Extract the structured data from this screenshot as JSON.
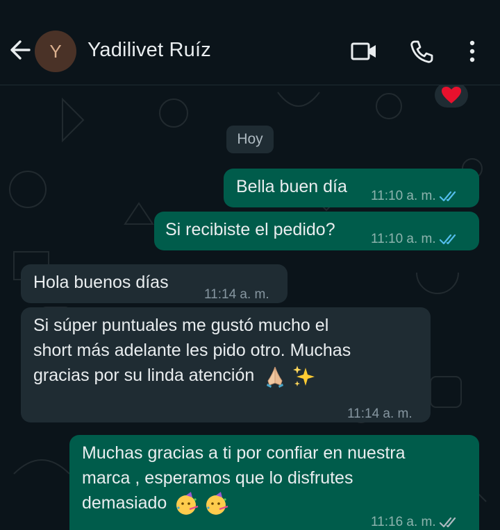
{
  "header": {
    "avatar_initial": "Y",
    "contact_name": "Yadilivet Ruíz",
    "icons": [
      "back-arrow-icon",
      "video-call-icon",
      "phone-icon",
      "more-vertical-icon"
    ]
  },
  "chat": {
    "reaction_emoji": "heart",
    "date_chip": "Hoy",
    "messages": [
      {
        "direction": "out",
        "text": "Bella buen día",
        "time": "11:10 a. m.",
        "status": "read"
      },
      {
        "direction": "out",
        "text": "Si recibiste el pedido?",
        "time": "11:10 a. m.",
        "status": "read"
      },
      {
        "direction": "in",
        "text": "Hola buenos días",
        "time": "11:14 a. m."
      },
      {
        "direction": "in",
        "lines": [
          "Si súper puntuales me gustó mucho el",
          "short más adelante les pido otro. Muchas",
          "gracias por su linda atención"
        ],
        "emojis": [
          "folded-hands",
          "sparkles"
        ],
        "time": "11:14 a. m."
      },
      {
        "direction": "out",
        "lines": [
          "Muchas gracias a ti por confiar en  nuestra",
          "marca , esperamos que lo disfrutes",
          "demasiado"
        ],
        "emojis": [
          "partying-face",
          "partying-face"
        ],
        "time": "11:16 a. m.",
        "status": "delivered"
      }
    ]
  },
  "colors": {
    "background": "#0b141a",
    "outgoing_bubble": "#005c4b",
    "incoming_bubble": "#1f2c33",
    "read_tick": "#53bdeb",
    "delivered_tick": "#aebac1"
  }
}
